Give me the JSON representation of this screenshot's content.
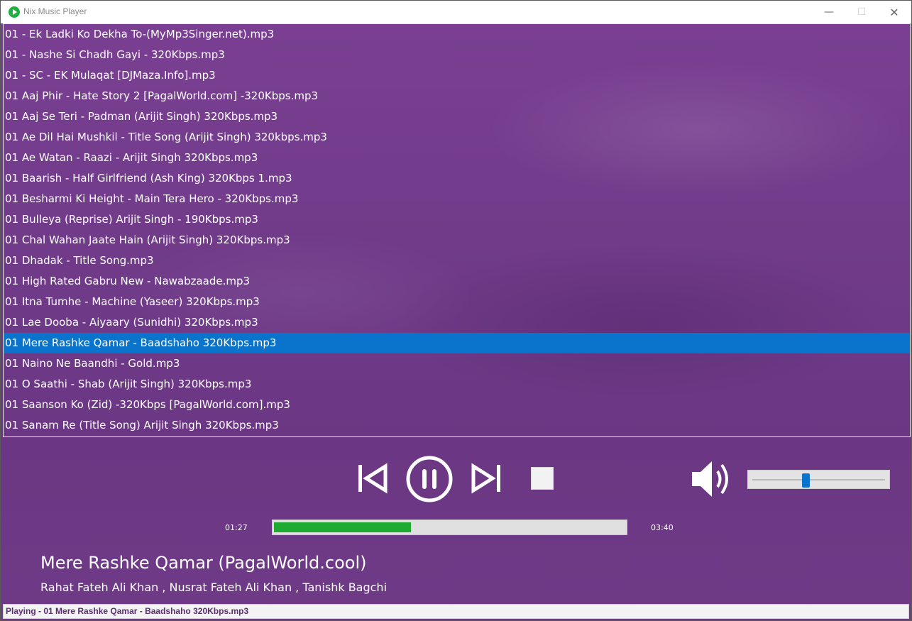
{
  "window": {
    "title": "Nix Music Player",
    "minimize_glyph": "—",
    "maximize_glyph": "☐",
    "close_glyph": "✕"
  },
  "playlist": {
    "selected_index": 15,
    "items": [
      "01 - Ek Ladki Ko Dekha To-(MyMp3Singer.net).mp3",
      "01 - Nashe Si Chadh Gayi - 320Kbps.mp3",
      "01 - SC - EK Mulaqat [DJMaza.Info].mp3",
      "01 Aaj Phir - Hate Story 2 [PagalWorld.com] -320Kbps.mp3",
      "01 Aaj Se Teri - Padman (Arijit Singh) 320Kbps.mp3",
      "01 Ae Dil Hai Mushkil - Title Song (Arijit Singh) 320kbps.mp3",
      "01 Ae Watan - Raazi - Arijit Singh 320Kbps.mp3",
      "01 Baarish - Half Girlfriend (Ash King) 320Kbps 1.mp3",
      "01 Besharmi Ki Height - Main Tera Hero - 320Kbps.mp3",
      "01 Bulleya (Reprise) Arijit Singh - 190Kbps.mp3",
      "01 Chal Wahan Jaate Hain (Arijit Singh) 320Kbps.mp3",
      "01 Dhadak - Title Song.mp3",
      "01 High Rated Gabru New - Nawabzaade.mp3",
      "01 Itna Tumhe - Machine (Yaseer) 320Kbps.mp3",
      "01 Lae Dooba - Aiyaary (Sunidhi) 320Kbps.mp3",
      "01 Mere Rashke Qamar - Baadshaho 320Kbps.mp3",
      "01 Naino Ne Baandhi - Gold.mp3",
      "01 O Saathi - Shab (Arijit Singh) 320Kbps.mp3",
      "01 Saanson Ko (Zid) -320Kbps [PagalWorld.com].mp3",
      "01 Sanam Re (Title Song) Arijit Singh 320Kbps.mp3"
    ]
  },
  "player": {
    "elapsed": "01:27",
    "total": "03:40",
    "progress_fraction": 0.39,
    "volume_fraction": 0.4,
    "icons": [
      "previous-icon",
      "pause-icon",
      "next-icon",
      "stop-icon",
      "speaker-icon"
    ]
  },
  "now_playing": {
    "title": "Mere Rashke Qamar (PagalWorld.cool)",
    "artists": "Rahat Fateh Ali Khan , Nusrat Fateh Ali Khan , Tanishk Bagchi"
  },
  "status": {
    "text": "Playing - 01 Mere Rashke Qamar - Baadshaho 320Kbps.mp3"
  },
  "colors": {
    "background": "#6f3a86",
    "selection": "#0a74cc",
    "progress": "#1faa32",
    "status_text": "#5b2d73"
  }
}
